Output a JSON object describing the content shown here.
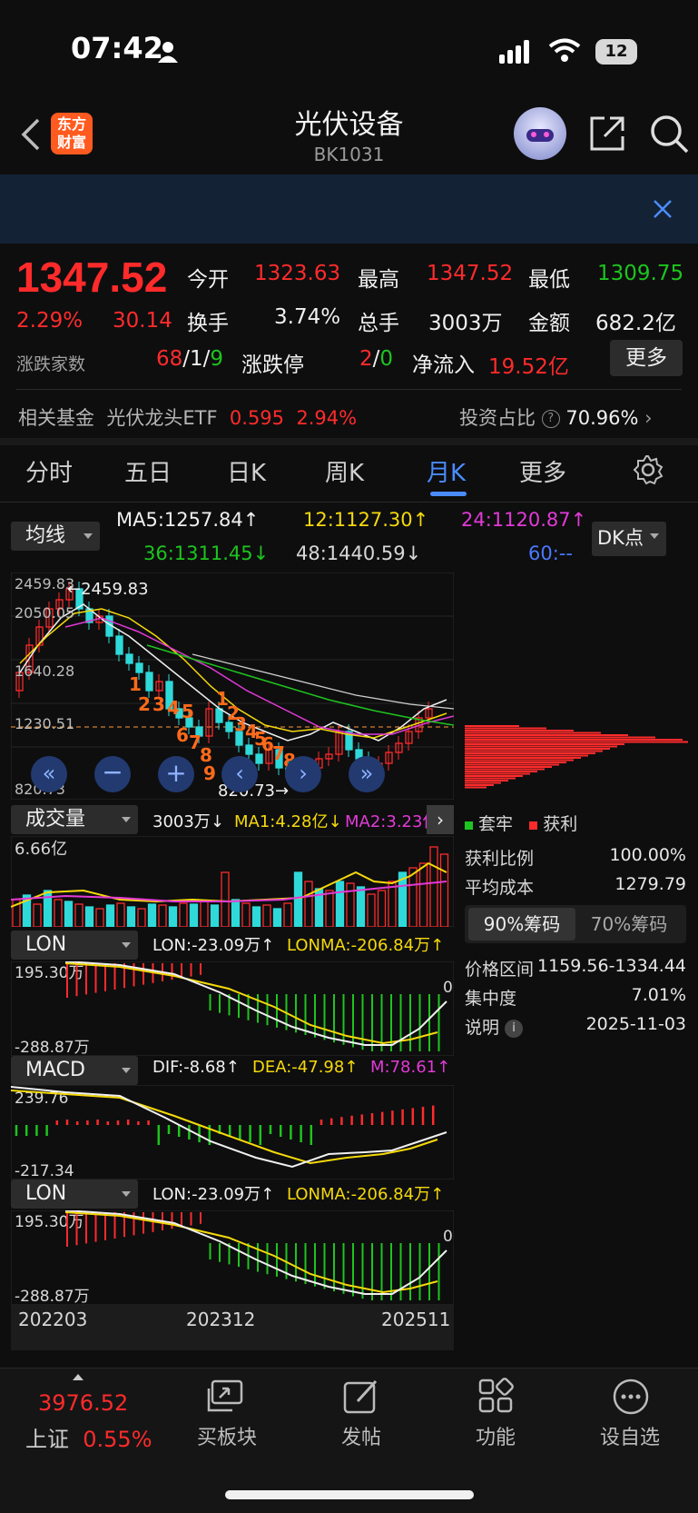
{
  "status": {
    "time": "07:42",
    "battery": "12"
  },
  "header": {
    "logo_line1": "东方",
    "logo_line2": "财富",
    "title": "光伏设备",
    "code": "BK1031"
  },
  "quote": {
    "price": "1347.52",
    "change_pct": "2.29%",
    "change": "30.14",
    "open_label": "今开",
    "open": "1323.63",
    "high_label": "最高",
    "high": "1347.52",
    "low_label": "最低",
    "low": "1309.75",
    "turnover_label": "换手",
    "turnover": "3.74%",
    "volume_label": "总手",
    "volume": "3003万",
    "amount_label": "金额",
    "amount": "682.2亿",
    "updown_label": "涨跌家数",
    "up": "68",
    "flat": "1",
    "down": "9",
    "limit_label": "涨跌停",
    "limit_up": "2",
    "limit_down": "0",
    "inflow_label": "净流入",
    "inflow": "19.52亿",
    "more": "更多"
  },
  "fund": {
    "label": "相关基金",
    "name": "光伏龙头ETF",
    "price": "0.595",
    "pct": "2.94%",
    "ratio_label": "投资占比",
    "ratio": "70.96%"
  },
  "tabs": [
    "分时",
    "五日",
    "日K",
    "周K",
    "月K",
    "更多"
  ],
  "ma": {
    "selector": "均线",
    "dk": "DK点",
    "ma5": "MA5:1257.84",
    "ma12": "12:1127.30",
    "ma24": "24:1120.87",
    "ma36": "36:1311.45",
    "ma48": "48:1440.59",
    "ma60": "60:--"
  },
  "kline": {
    "y_labels": [
      "2459.83",
      "2050.05",
      "1640.28",
      "1230.51",
      "820.73"
    ],
    "high_mark": "2459.83",
    "low_mark": "820.73",
    "nums_a": [
      "1",
      "2",
      "3",
      "4",
      "5",
      "6",
      "7",
      "8",
      "9"
    ],
    "nums_b": [
      "1",
      "2",
      "3",
      "4",
      "5",
      "6",
      "7",
      "8",
      "9"
    ]
  },
  "volume": {
    "selector": "成交量",
    "vol": "3003万",
    "ma1": "MA1:4.28亿",
    "ma2": "MA2:3.23亿",
    "max": "6.66亿"
  },
  "lon1": {
    "selector": "LON",
    "lon": "LON:-23.09万",
    "lonma": "LONMA:-206.84万",
    "top": "195.30万",
    "bottom": "-288.87万",
    "zero": "0"
  },
  "macd": {
    "selector": "MACD",
    "dif": "DIF:-8.68",
    "dea": "DEA:-47.98",
    "m": "M:78.61",
    "top": "239.76",
    "bottom": "-217.34"
  },
  "lon2": {
    "selector": "LON",
    "lon": "LON:-23.09万",
    "lonma": "LONMA:-206.84万",
    "top": "195.30万",
    "bottom": "-288.87万",
    "zero": "0"
  },
  "dates": [
    "202203",
    "202312",
    "202511"
  ],
  "chips": {
    "legend_trapped": "套牢",
    "legend_profit": "获利",
    "profit_ratio_label": "获利比例",
    "profit_ratio": "100.00%",
    "avg_cost_label": "平均成本",
    "avg_cost": "1279.79",
    "tab90": "90%筹码",
    "tab70": "70%筹码",
    "range_label": "价格区间",
    "range": "1159.56-1334.44",
    "conc_label": "集中度",
    "conc": "7.01%",
    "note_label": "说明",
    "date": "2025-11-03"
  },
  "bottom": {
    "index_value": "3976.52",
    "index_name": "上证",
    "index_pct": "0.55%",
    "nav": [
      "买板块",
      "发帖",
      "功能",
      "设自选"
    ]
  },
  "colors": {
    "up": "#ff2b2b",
    "down": "#1ec41e",
    "candle_down": "#2fd9d9",
    "accent": "#4a8cff"
  }
}
